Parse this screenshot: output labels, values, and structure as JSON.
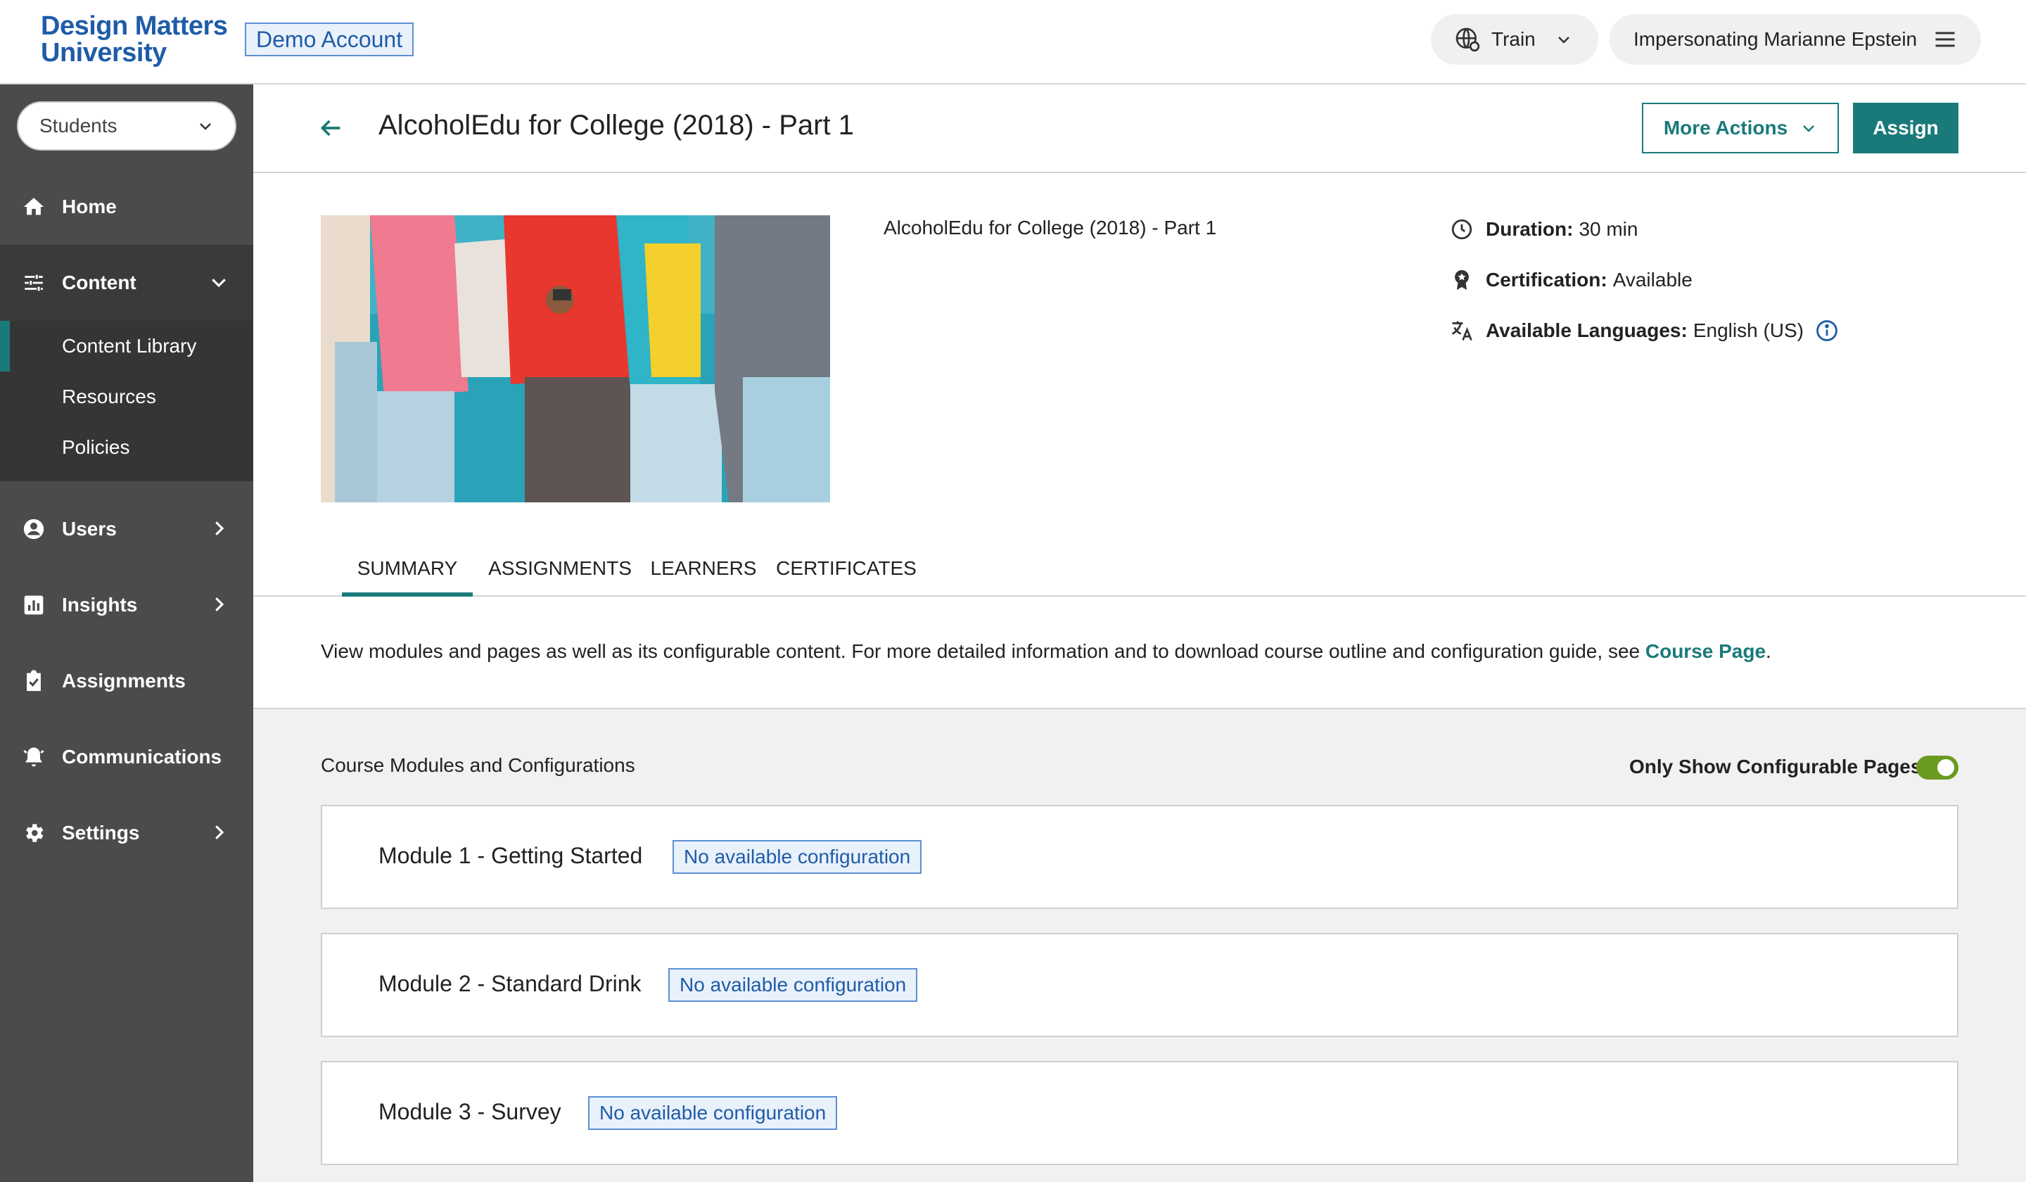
{
  "topbar": {
    "logo_line1": "Design Matters",
    "logo_line2": "University",
    "demo_badge": "Demo Account",
    "environment_label": "Train",
    "impersonating_label": "Impersonating Marianne Epstein"
  },
  "sidebar": {
    "role_select": "Students",
    "items": [
      {
        "label": "Home",
        "icon": "home-icon"
      },
      {
        "label": "Content",
        "icon": "sliders-icon"
      },
      {
        "label": "Users",
        "icon": "account-circle-icon"
      },
      {
        "label": "Insights",
        "icon": "bar-chart-icon"
      },
      {
        "label": "Assignments",
        "icon": "clipboard-check-icon"
      },
      {
        "label": "Communications",
        "icon": "bell-icon"
      },
      {
        "label": "Settings",
        "icon": "gear-icon"
      }
    ],
    "content_subitems": [
      "Content Library",
      "Resources",
      "Policies"
    ]
  },
  "header": {
    "title": "AlcoholEdu for College (2018) - Part 1",
    "more_actions": "More Actions",
    "assign": "Assign"
  },
  "course": {
    "name": "AlcoholEdu for College (2018) - Part 1",
    "duration_label": "Duration:",
    "duration_value": "30 min",
    "certification_label": "Certification:",
    "certification_value": "Available",
    "languages_label": "Available Languages:",
    "languages_value": "English (US)"
  },
  "tabs": [
    "SUMMARY",
    "ASSIGNMENTS",
    "LEARNERS",
    "CERTIFICATES"
  ],
  "description": {
    "text": "View modules and pages as well as its configurable content. For more detailed information and to download course outline and configuration guide, see",
    "link": "Course Page",
    "trailing": "."
  },
  "modules_section": {
    "title": "Course Modules and Configurations",
    "toggle_label": "Only Show Configurable Pages",
    "toggle_on": true,
    "modules": [
      {
        "name": "Module 1 - Getting Started",
        "badge": "No available configuration"
      },
      {
        "name": "Module 2 - Standard Drink",
        "badge": "No available configuration"
      },
      {
        "name": "Module 3 - Survey",
        "badge": "No available configuration"
      }
    ]
  },
  "colors": {
    "accent": "#1a7a7a",
    "brand": "#1f5ca8",
    "sidebar": "#4b4b4b",
    "toggle": "#6a9a1f"
  }
}
